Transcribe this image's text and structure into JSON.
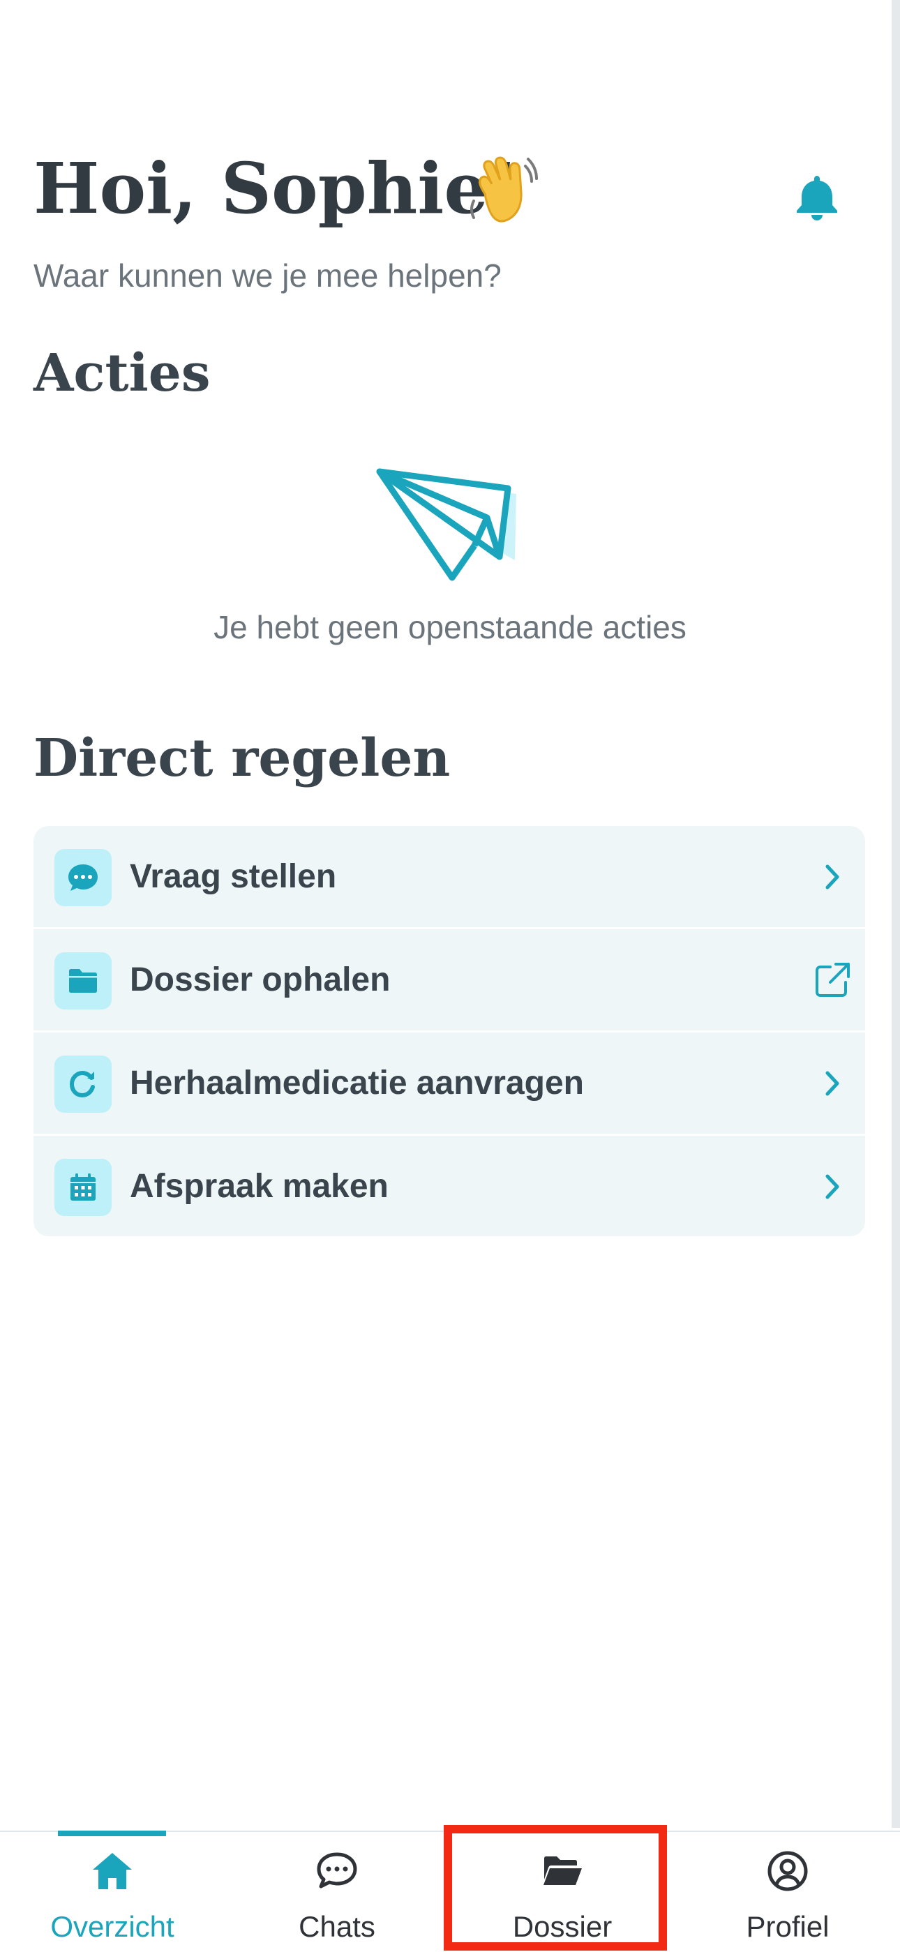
{
  "header": {
    "greeting": "Hoi, Sophie!",
    "subtitle": "Waar kunnen we je mee helpen?",
    "wave_icon": "waving-hand-icon",
    "bell_icon": "bell-icon"
  },
  "actions_section": {
    "title": "Acties",
    "empty_icon": "paper-plane-icon",
    "empty_text": "Je hebt geen openstaande acties"
  },
  "direct_section": {
    "title": "Direct regelen",
    "items": [
      {
        "label": "Vraag stellen",
        "icon": "chat-bubble-icon",
        "trailing": "chevron-right-icon"
      },
      {
        "label": "Dossier ophalen",
        "icon": "folder-icon",
        "trailing": "external-link-icon"
      },
      {
        "label": "Herhaalmedicatie aanvragen",
        "icon": "refresh-icon",
        "trailing": "chevron-right-icon"
      },
      {
        "label": "Afspraak maken",
        "icon": "calendar-icon",
        "trailing": "chevron-right-icon"
      }
    ]
  },
  "bottom_nav": {
    "items": [
      {
        "label": "Overzicht",
        "icon": "home-icon",
        "active": true
      },
      {
        "label": "Chats",
        "icon": "chat-icon",
        "active": false
      },
      {
        "label": "Dossier",
        "icon": "folder-open-icon",
        "active": false
      },
      {
        "label": "Profiel",
        "icon": "user-circle-icon",
        "active": false
      }
    ]
  },
  "colors": {
    "accent": "#1aa5bd",
    "icon_tile": "#bdf0f8",
    "list_bg": "#eef6f8",
    "text_dark": "#3a444c",
    "text_muted": "#6b747b",
    "highlight": "#f22a14"
  }
}
